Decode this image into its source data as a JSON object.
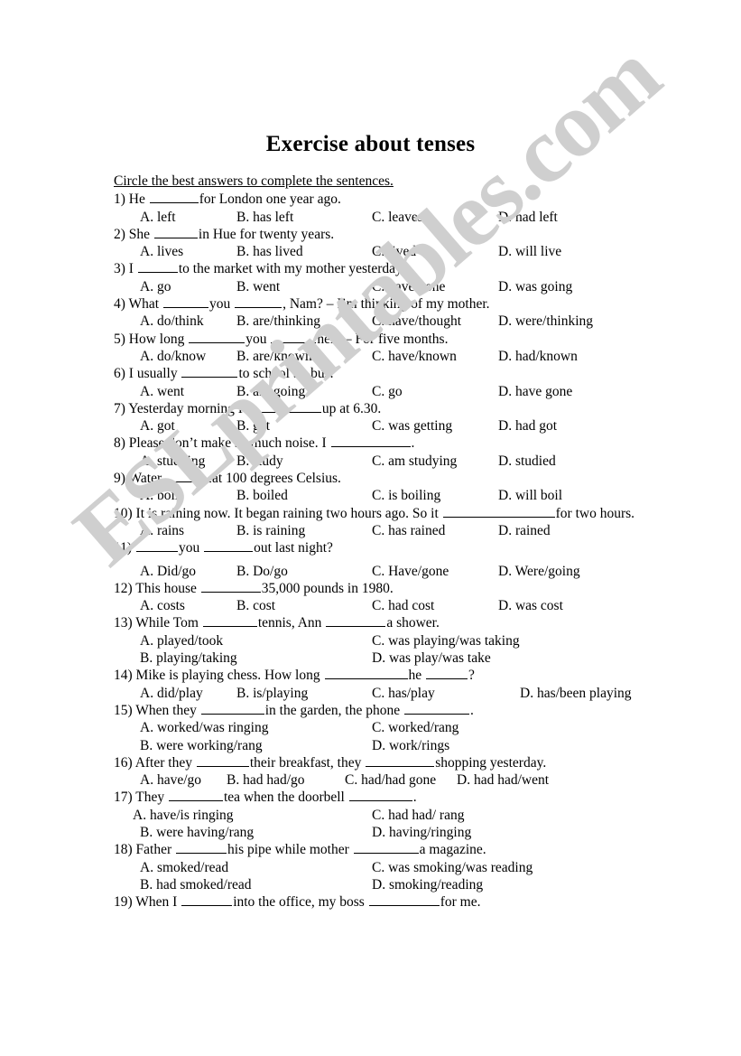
{
  "document": {
    "title": "Exercise about tenses",
    "instruction": "Circle the best answers to complete the sentences.",
    "watermark": "ESLprintables.com",
    "watermark_color": "#cfcfcf"
  },
  "questions": [
    {
      "number": "1)",
      "stem_before": "He ",
      "stem_after": "for London one year ago.",
      "options": [
        "A. left",
        "B. has left",
        "C. leaves",
        "D. had left"
      ],
      "layout": "four-column"
    },
    {
      "number": "2)",
      "stem_before": "She ",
      "stem_after": "in Hue for twenty years.",
      "options": [
        "A. lives",
        "B. has lived",
        "C. lived",
        "D. will live"
      ],
      "layout": "four-column"
    },
    {
      "number": "3)",
      "stem_before": "I ",
      "stem_after": "to the market with my mother yesterday.",
      "options": [
        "A. go",
        "B. went",
        "C. have gone",
        "D. was going"
      ],
      "layout": "four-column"
    },
    {
      "number": "4)",
      "stem_before": "What ",
      "stem_mid": "you ",
      "stem_after": ", Nam? – I’m thinking of my mother.",
      "options": [
        "A. do/think",
        "B. are/thinking",
        "C. have/thought",
        "D. were/thinking"
      ],
      "layout": "four-column"
    },
    {
      "number": "5)",
      "stem_before": "How long ",
      "stem_mid": "you ",
      "stem_after": "her? – For five months.",
      "options": [
        "A. do/know",
        "B. are/knowing",
        "C. have/known",
        "D. had/known"
      ],
      "layout": "four-column"
    },
    {
      "number": "6)",
      "stem_before": "I usually ",
      "stem_after": "to school by bus.",
      "options": [
        "A. went",
        "B. am going",
        "C. go",
        "D. have gone"
      ],
      "layout": "four-column"
    },
    {
      "number": "7)",
      "stem_before": "Yesterday morning I ",
      "stem_after": "up at 6.30.",
      "options": [
        "A. got",
        "B. get",
        "C. was getting",
        "D. had got"
      ],
      "layout": "four-column"
    },
    {
      "number": "8)",
      "stem_before": "Please don’t make so much noise. I ",
      "stem_after": ".",
      "options": [
        "A. studying",
        "B. study",
        "C. am studying",
        "D. studied"
      ],
      "layout": "four-column"
    },
    {
      "number": "9)",
      "stem_before": "Water ",
      "stem_after": "at 100 degrees Celsius.",
      "options": [
        "A. boils",
        "B. boiled",
        "C. is boiling",
        "D. will boil"
      ],
      "layout": "four-column"
    },
    {
      "number": "10)",
      "stem_before": "It is raining now. It began raining two hours ago. So it ",
      "stem_after": "for two hours.",
      "options": [
        "A. rains",
        "B. is raining",
        "C. has rained",
        "D. rained"
      ],
      "layout": "four-column"
    },
    {
      "number": "11)",
      "stem_before": " ",
      "stem_mid": "you ",
      "stem_after": "out last night?",
      "options": [
        "A. Did/go",
        "B. Do/go",
        "C. Have/gone",
        "D. Were/going"
      ],
      "layout": "four-column"
    },
    {
      "number": "12)",
      "stem_before": "This house ",
      "stem_after": "35,000 pounds in 1980.",
      "options": [
        "A. costs",
        "B. cost",
        "C. had cost",
        "D. was cost"
      ],
      "layout": "four-column"
    },
    {
      "number": "13)",
      "stem_before": "While Tom ",
      "stem_mid": "tennis, Ann ",
      "stem_after": "a shower.",
      "options": [
        "A. played/took",
        "B. playing/taking",
        "C. was playing/was taking",
        "D. was play/was take"
      ],
      "layout": "two-column"
    },
    {
      "number": "14)",
      "stem_before": "Mike is playing chess. How long ",
      "stem_mid": "he ",
      "stem_after": "?",
      "options": [
        "A. did/play",
        "B. is/playing",
        "C. has/play",
        "D. has/been playing"
      ],
      "layout": "four-column-wide"
    },
    {
      "number": "15)",
      "stem_before": "When they ",
      "stem_mid": "in the garden, the phone ",
      "stem_after": ".",
      "options": [
        "A. worked/was ringing",
        "B. were working/rang",
        "C. worked/rang",
        "D. work/rings"
      ],
      "layout": "two-column"
    },
    {
      "number": "16)",
      "stem_before": "After they ",
      "stem_mid": "their breakfast, they ",
      "stem_after": "shopping yesterday.",
      "options": [
        "A. have/go",
        "B. had had/go",
        "C. had/had gone",
        "D. had had/went"
      ],
      "layout": "four-column-tight"
    },
    {
      "number": "17)",
      "stem_before": "They ",
      "stem_mid": "tea when the doorbell ",
      "stem_after": ".",
      "options": [
        "A. have/is ringing",
        "B. were having/rang",
        "C. had had/ rang",
        "D. having/ringing"
      ],
      "layout": "two-column"
    },
    {
      "number": "18)",
      "stem_before": "Father ",
      "stem_mid": "his pipe while mother ",
      "stem_after": "a magazine.",
      "options": [
        "A. smoked/read",
        "B. had smoked/read",
        "C. was smoking/was reading",
        "D. smoking/reading"
      ],
      "layout": "two-column"
    },
    {
      "number": "19)",
      "stem_before": "When I ",
      "stem_mid": "into the office, my boss ",
      "stem_after": "for me.",
      "options": [],
      "layout": "none"
    }
  ]
}
